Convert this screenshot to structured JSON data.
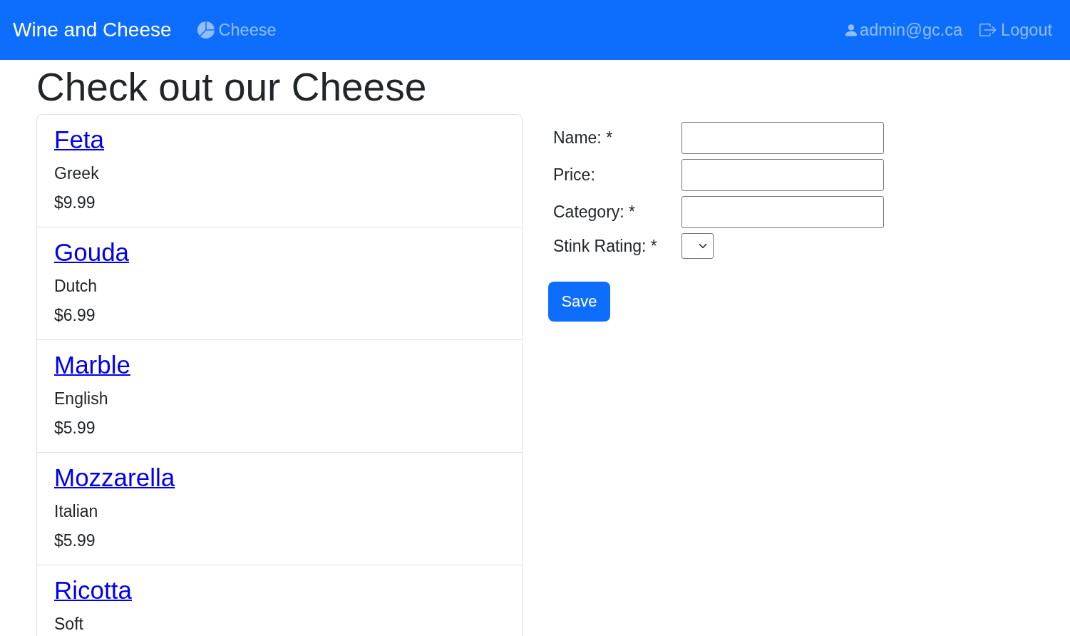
{
  "navbar": {
    "brand": "Wine and Cheese",
    "links": [
      {
        "label": "Cheese"
      }
    ],
    "user": "admin@gc.ca",
    "logout": "Logout"
  },
  "heading": "Check out our Cheese",
  "cheeses": [
    {
      "name": "Feta",
      "category": "Greek",
      "price": "$9.99"
    },
    {
      "name": "Gouda",
      "category": "Dutch",
      "price": "$6.99"
    },
    {
      "name": "Marble",
      "category": "English",
      "price": "$5.99"
    },
    {
      "name": "Mozzarella",
      "category": "Italian",
      "price": "$5.99"
    },
    {
      "name": "Ricotta",
      "category": "Soft"
    }
  ],
  "form": {
    "fields": [
      {
        "label": "Name: *",
        "kind": "text"
      },
      {
        "label": "Price:",
        "kind": "text"
      },
      {
        "label": "Category: *",
        "kind": "text"
      },
      {
        "label": "Stink Rating: *",
        "kind": "select"
      }
    ],
    "button": "Save"
  }
}
